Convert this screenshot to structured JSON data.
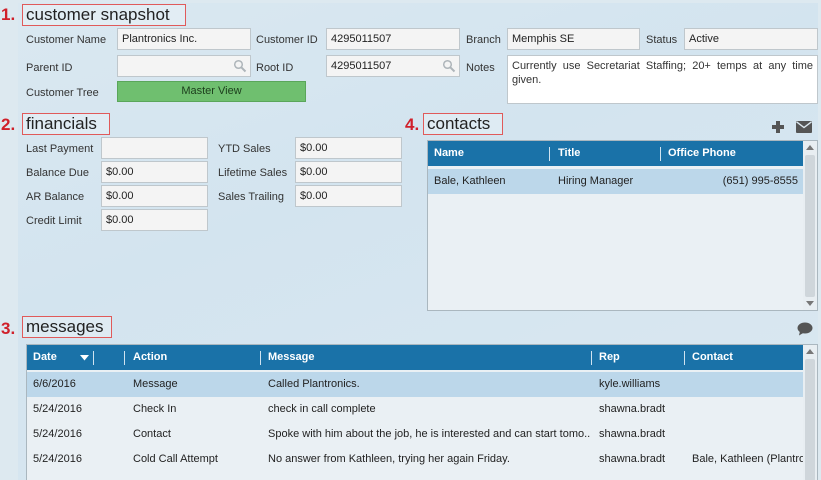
{
  "snapshot": {
    "number": "1.",
    "title": "customer snapshot",
    "customer_name_label": "Customer Name",
    "customer_name": "Plantronics Inc.",
    "customer_id_label": "Customer ID",
    "customer_id": "4295011507",
    "branch_label": "Branch",
    "branch": "Memphis SE",
    "status_label": "Status",
    "status": "Active",
    "parent_id_label": "Parent ID",
    "parent_id": "",
    "root_id_label": "Root ID",
    "root_id": "4295011507",
    "notes_label": "Notes",
    "notes": "Currently use Secretariat Staffing; 20+ temps at any time given.",
    "customer_tree_label": "Customer Tree",
    "master_view_label": "Master View"
  },
  "financials": {
    "number": "2.",
    "title": "financials",
    "last_payment_label": "Last Payment",
    "last_payment": "",
    "balance_due_label": "Balance Due",
    "balance_due": "$0.00",
    "ar_balance_label": "AR Balance",
    "ar_balance": "$0.00",
    "credit_limit_label": "Credit Limit",
    "credit_limit": "$0.00",
    "ytd_sales_label": "YTD Sales",
    "ytd_sales": "$0.00",
    "lifetime_sales_label": "Lifetime Sales",
    "lifetime_sales": "$0.00",
    "sales_trailing_label": "Sales Trailing",
    "sales_trailing": "$0.00"
  },
  "contacts": {
    "number": "4.",
    "title": "contacts",
    "add_icon": "plus-icon",
    "email_icon": "envelope-icon",
    "columns": [
      "Name",
      "Title",
      "Office Phone"
    ],
    "rows": [
      {
        "name": "Bale, Kathleen",
        "title": "Hiring Manager",
        "phone": "(651) 995-8555"
      }
    ]
  },
  "messages": {
    "number": "3.",
    "title": "messages",
    "comment_icon": "speech-bubble-icon",
    "columns": [
      "Date",
      "Action",
      "Message",
      "Rep",
      "Contact"
    ],
    "rows": [
      {
        "date": "6/6/2016",
        "action": "Message",
        "message": "Called Plantronics.",
        "rep": "kyle.williams",
        "contact": ""
      },
      {
        "date": "5/24/2016",
        "action": "Check In",
        "message": "check in call complete",
        "rep": "shawna.bradt",
        "contact": ""
      },
      {
        "date": "5/24/2016",
        "action": "Contact",
        "message": "Spoke with him about the job, he is interested and can start tomo...",
        "rep": "shawna.bradt",
        "contact": ""
      },
      {
        "date": "5/24/2016",
        "action": "Cold Call Attempt",
        "message": "No answer from Kathleen, trying her again Friday.",
        "rep": "shawna.bradt",
        "contact": "Bale, Kathleen (Plantro"
      }
    ]
  },
  "colors": {
    "header_blue": "#1a72a8",
    "selected_row": "#bcd7ea",
    "master_view_green": "#6fbf6f",
    "annotation_red": "#d0202a"
  }
}
